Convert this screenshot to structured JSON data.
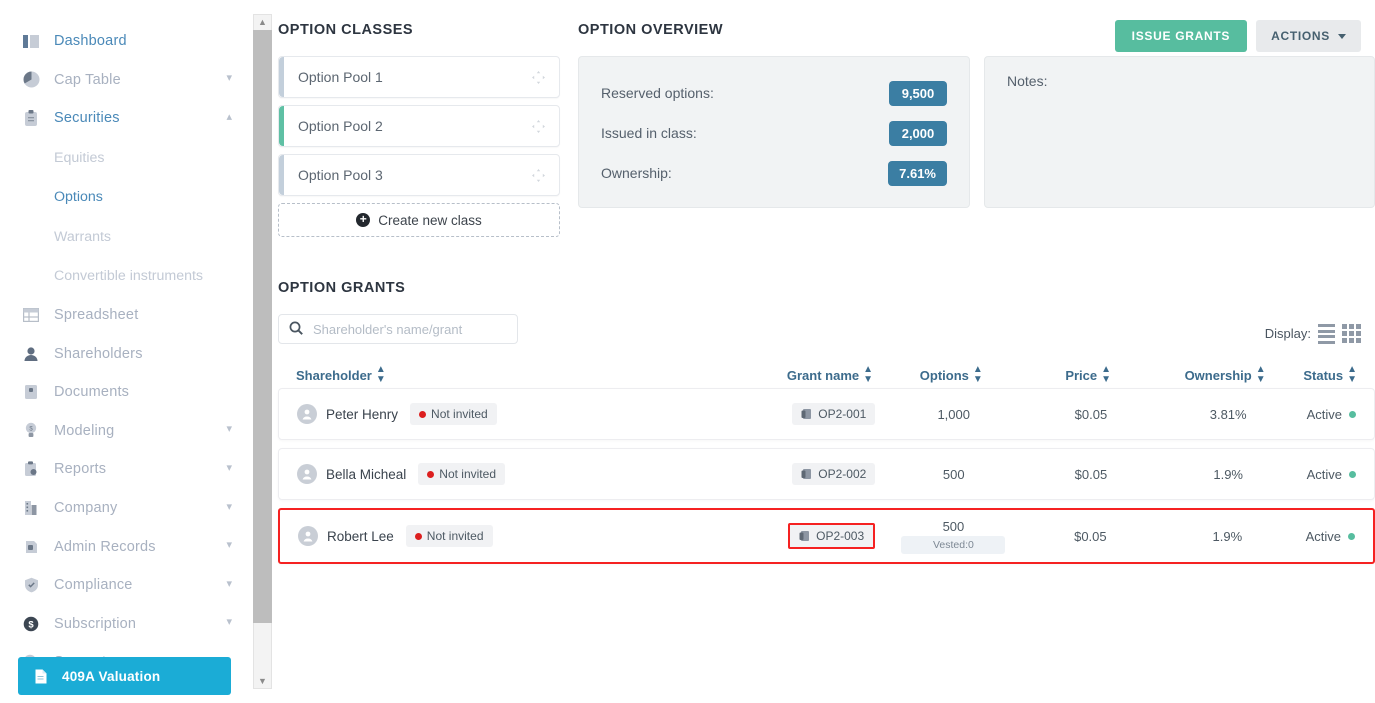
{
  "sidebar": {
    "items": [
      {
        "label": "Dashboard",
        "icon": "dashboard-icon",
        "active": true,
        "expandable": false
      },
      {
        "label": "Cap Table",
        "icon": "pie-chart-icon",
        "active": false,
        "expandable": true,
        "chevron": "down"
      },
      {
        "label": "Securities",
        "icon": "clipboard-icon",
        "active": true,
        "expandable": true,
        "chevron": "up"
      },
      {
        "label": "Spreadsheet",
        "icon": "table-icon",
        "active": false,
        "expandable": false
      },
      {
        "label": "Shareholders",
        "icon": "person-icon",
        "active": false,
        "expandable": false
      },
      {
        "label": "Documents",
        "icon": "document-icon",
        "active": false,
        "expandable": false
      },
      {
        "label": "Modeling",
        "icon": "lightbulb-icon",
        "active": false,
        "expandable": true,
        "chevron": "down"
      },
      {
        "label": "Reports",
        "icon": "report-icon",
        "active": false,
        "expandable": true,
        "chevron": "down"
      },
      {
        "label": "Company",
        "icon": "building-icon",
        "active": false,
        "expandable": true,
        "chevron": "down"
      },
      {
        "label": "Admin Records",
        "icon": "archive-icon",
        "active": false,
        "expandable": true,
        "chevron": "down"
      },
      {
        "label": "Compliance",
        "icon": "shield-check-icon",
        "active": false,
        "expandable": true,
        "chevron": "down"
      },
      {
        "label": "Subscription",
        "icon": "dollar-circle-icon",
        "active": false,
        "expandable": true,
        "chevron": "down"
      },
      {
        "label": "Support",
        "icon": "support-icon",
        "active": false,
        "expandable": false
      }
    ],
    "securities_subitems": [
      {
        "label": "Equities",
        "active": false
      },
      {
        "label": "Options",
        "active": true
      },
      {
        "label": "Warrants",
        "active": false
      },
      {
        "label": "Convertible instruments",
        "active": false
      }
    ],
    "valuation_button": {
      "label": "409A Valuation",
      "icon": "file-icon",
      "color": "#1bacd6"
    }
  },
  "toolbar": {
    "issue_grants_label": "ISSUE GRANTS",
    "actions_label": "ACTIONS",
    "issue_color": "#57bd9f"
  },
  "option_classes": {
    "title": "OPTION CLASSES",
    "cards": [
      {
        "label": "Option Pool 1",
        "accent": "#c3cfdb",
        "selected": false
      },
      {
        "label": "Option Pool 2",
        "accent": "#5fc0a4",
        "selected": true
      },
      {
        "label": "Option Pool 3",
        "accent": "#c3cfdb",
        "selected": false
      }
    ],
    "create_label": "Create new class"
  },
  "option_overview": {
    "title": "OPTION OVERVIEW",
    "stats": [
      {
        "key": "Reserved options:",
        "value": "9,500"
      },
      {
        "key": "Issued in class:",
        "value": "2,000"
      },
      {
        "key": "Ownership:",
        "value": "7.61%"
      }
    ],
    "pill_color": "#3b7ea3",
    "notes_label": "Notes:",
    "notes_value": ""
  },
  "option_grants": {
    "title": "OPTION GRANTS",
    "search": {
      "value": "",
      "placeholder": "Shareholder's name/grant"
    },
    "display": {
      "label": "Display:",
      "list_icon": "list-view-icon",
      "grid_icon": "grid-view-icon"
    },
    "columns": [
      {
        "label": "Shareholder",
        "sortable": true
      },
      {
        "label": "Grant name",
        "sortable": true
      },
      {
        "label": "Options",
        "sortable": true
      },
      {
        "label": "Price",
        "sortable": true
      },
      {
        "label": "Ownership",
        "sortable": true
      },
      {
        "label": "Status",
        "sortable": true
      }
    ],
    "rows": [
      {
        "shareholder": "Peter Henry",
        "invite_status": "Not invited",
        "grant_name": "OP2-001",
        "options": "1,000",
        "vested": "",
        "price": "$0.05",
        "ownership": "3.81%",
        "status": "Active",
        "highlighted": false,
        "grant_boxed": false
      },
      {
        "shareholder": "Bella Micheal",
        "invite_status": "Not invited",
        "grant_name": "OP2-002",
        "options": "500",
        "vested": "",
        "price": "$0.05",
        "ownership": "1.9%",
        "status": "Active",
        "highlighted": false,
        "grant_boxed": false
      },
      {
        "shareholder": "Robert Lee",
        "invite_status": "Not invited",
        "grant_name": "OP2-003",
        "options": "500",
        "vested": "Vested:0",
        "price": "$0.05",
        "ownership": "1.9%",
        "status": "Active",
        "highlighted": true,
        "grant_boxed": true
      }
    ],
    "highlight_color": "#f52121"
  }
}
